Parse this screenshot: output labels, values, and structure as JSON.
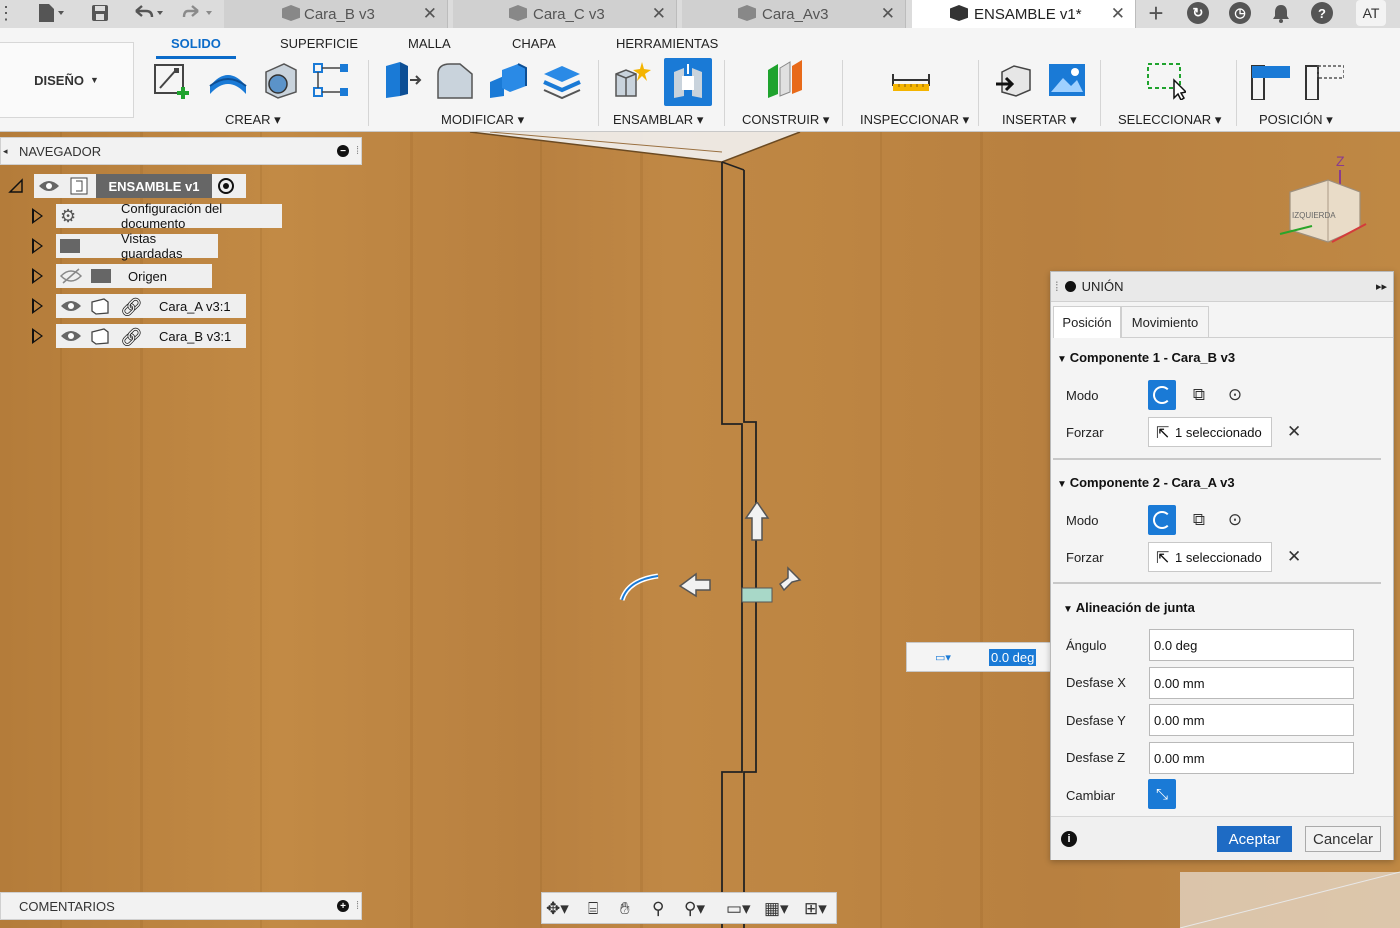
{
  "tabs": [
    {
      "label": "Cara_B v3"
    },
    {
      "label": "Cara_C v3"
    },
    {
      "label": "Cara_Av3"
    },
    {
      "label": "ENSAMBLE v1*"
    }
  ],
  "user_initials": "AT",
  "design_mode": "DISEÑO",
  "ribbon_tabs": [
    "SOLIDO",
    "SUPERFICIE",
    "MALLA",
    "CHAPA",
    "HERRAMIENTAS"
  ],
  "groups": [
    "CREAR",
    "MODIFICAR",
    "ENSAMBLAR",
    "CONSTRUIR",
    "INSPECCIONAR",
    "INSERTAR",
    "SELECCIONAR",
    "POSICIÓN"
  ],
  "navigator": {
    "title": "NAVEGADOR",
    "root": "ENSAMBLE v1",
    "items": [
      {
        "label": "Configuración del documento",
        "icon": "gear-icon"
      },
      {
        "label": "Vistas guardadas",
        "icon": "folder-icon"
      },
      {
        "label": "Origen",
        "icon": "folder-icon"
      },
      {
        "label": "Cara_A v3:1",
        "icon": "component-icon"
      },
      {
        "label": "Cara_B v3:1",
        "icon": "component-icon"
      }
    ]
  },
  "comments_label": "COMENTARIOS",
  "viewcube_label": "IZQUIERDA",
  "viewcube_axis": "Z",
  "angle_input": "0.0 deg",
  "dialog": {
    "title": "UNIÓN",
    "tabs": [
      "Posición",
      "Movimiento"
    ],
    "comp1_title": "Componente 1 - Cara_B v3",
    "comp2_title": "Componente 2 - Cara_A v3",
    "mode_label": "Modo",
    "force_label": "Forzar",
    "selected_text": "1 seleccionado",
    "alignment_title": "Alineación de junta",
    "angle_label": "Ángulo",
    "angle_value": "0.0 deg",
    "offset_x_label": "Desfase X",
    "offset_x_value": "0.00 mm",
    "offset_y_label": "Desfase Y",
    "offset_y_value": "0.00 mm",
    "offset_z_label": "Desfase Z",
    "offset_z_value": "0.00 mm",
    "flip_label": "Cambiar",
    "ok_label": "Aceptar",
    "cancel_label": "Cancelar"
  },
  "colors": {
    "accent": "#0b6bc9",
    "wood": "#bd8542",
    "primary_button": "#1e6bc4"
  }
}
